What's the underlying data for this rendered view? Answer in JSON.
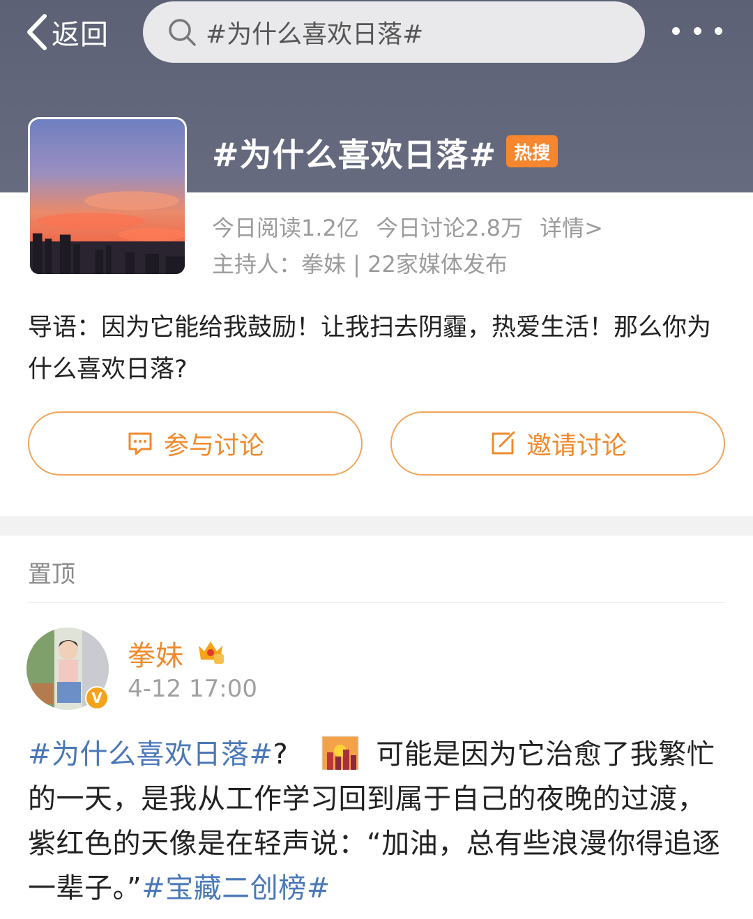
{
  "nav": {
    "back_label": "返回",
    "search_text": "#为什么喜欢日落#"
  },
  "topic": {
    "title": "#为什么喜欢日落#",
    "badge": "热搜",
    "reads": "今日阅读1.2亿",
    "discussions": "今日讨论2.8万",
    "details": "详情>",
    "host_line": "主持人：拳妹 | 22家媒体发布",
    "intro": "导语：因为它能给我鼓励！让我扫去阴霾，热爱生活！那么你为什么喜欢日落?"
  },
  "actions": {
    "join": "参与讨论",
    "invite": "邀请讨论"
  },
  "pinned": {
    "label": "置顶"
  },
  "post": {
    "author": "拳妹",
    "verified_mark": "V",
    "time": "4-12 17:00",
    "hashtag1": "#为什么喜欢日落#",
    "after_hashtag": "?",
    "text": "可能是因为它治愈了我繁忙的一天，是我从工作学习回到属于自己的夜晚的过渡，紫红色的天像是在轻声说：“加油，总有些浪漫你得追逐一辈子。”",
    "hashtag2": "#宝藏二创榜#"
  },
  "colors": {
    "header_bg": "#5d6175",
    "accent_orange": "#f08a2c",
    "hot_badge": "#f7862e",
    "hashtag_blue": "#4a78b8"
  },
  "icons": [
    "chevron-left-icon",
    "search-icon",
    "more-icon",
    "comment-icon",
    "edit-icon",
    "crown-icon",
    "sunset-emoji-icon"
  ]
}
